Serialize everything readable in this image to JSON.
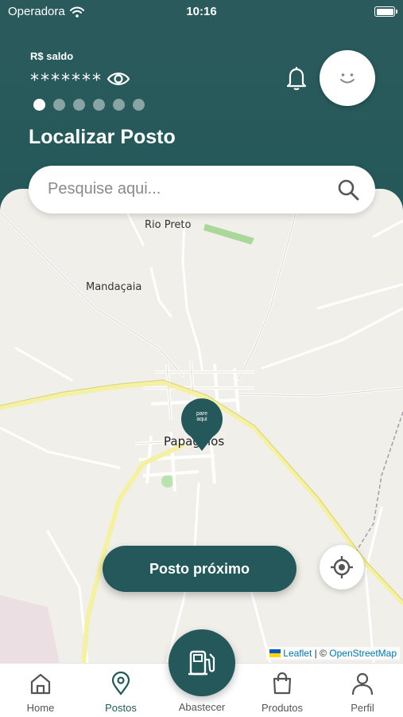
{
  "status_bar": {
    "carrier": "Operadora",
    "time": "10:16"
  },
  "header": {
    "balance_label": "R$ saldo",
    "balance_value": "*******",
    "carousel_dots": 6,
    "title": "Localizar Posto"
  },
  "search": {
    "placeholder": "Pesquise aqui..."
  },
  "map": {
    "labels": {
      "rio_preto": "Rio Preto",
      "mandacaia": "Mandaçaia",
      "papagaios": "Papagaios"
    },
    "pin_logo": "pare aqui",
    "attribution": {
      "leaflet": "Leaflet",
      "separator": "| ©",
      "osm": "OpenStreetMap"
    }
  },
  "actions": {
    "nearby_button": "Posto próximo"
  },
  "nav": {
    "home": "Home",
    "postos": "Postos",
    "abastecer": "Abastecer",
    "produtos": "Produtos",
    "perfil": "Perfil"
  },
  "colors": {
    "brand": "#24585a",
    "map_bg": "#f1efe9",
    "road_yellow": "#f4f1a4",
    "road_white": "#ffffff"
  },
  "icons": [
    "wifi-icon",
    "eye-icon",
    "bell-icon",
    "smiley-avatar-icon",
    "search-icon",
    "location-pin-icon",
    "locate-target-icon",
    "home-icon",
    "map-pin-icon",
    "fuel-pump-icon",
    "shopping-bag-icon",
    "user-icon"
  ]
}
